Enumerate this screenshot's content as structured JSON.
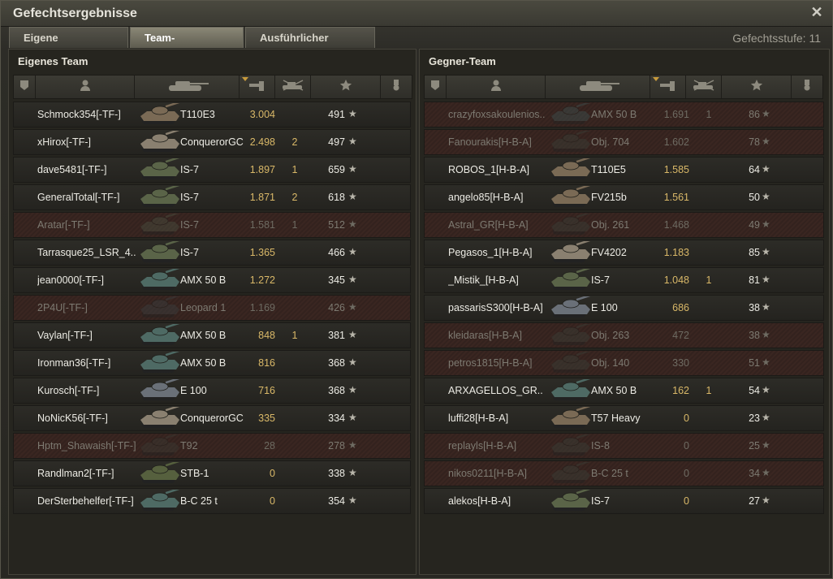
{
  "window": {
    "title": "Gefechtsergebnisse",
    "close_icon": "✕"
  },
  "tabs": [
    {
      "label": "Eigene Auswertung",
      "active": false
    },
    {
      "label": "Team-Auswertung",
      "active": true
    },
    {
      "label": "Ausführlicher Bericht",
      "active": false
    }
  ],
  "battle_level": {
    "label": "Gefechtsstufe:",
    "value": "11"
  },
  "columns": [
    {
      "icon": "platoon-icon"
    },
    {
      "icon": "player-icon"
    },
    {
      "icon": "tank-icon"
    },
    {
      "icon": "damage-icon",
      "sorted": true
    },
    {
      "icon": "kills-icon"
    },
    {
      "icon": "star-icon"
    },
    {
      "icon": "medal-icon"
    }
  ],
  "own_team": {
    "title": "Eigenes Team",
    "rows": [
      {
        "name": "Schmock354[-TF-]",
        "vehicle": "T110E3",
        "damage": "3.004",
        "kills": "",
        "xp": "491",
        "dead": false,
        "tank_color": "#7a6a55"
      },
      {
        "name": "xHirox[-TF-]",
        "vehicle": "ConquerorGC",
        "damage": "2.498",
        "kills": "2",
        "xp": "497",
        "dead": false,
        "tank_color": "#8a8070"
      },
      {
        "name": "dave5481[-TF-]",
        "vehicle": "IS-7",
        "damage": "1.897",
        "kills": "1",
        "xp": "659",
        "dead": false,
        "tank_color": "#5a6448"
      },
      {
        "name": "GeneralTotal[-TF-]",
        "vehicle": "IS-7",
        "damage": "1.871",
        "kills": "2",
        "xp": "618",
        "dead": false,
        "tank_color": "#5a6448"
      },
      {
        "name": "Aratar[-TF-]",
        "vehicle": "IS-7",
        "damage": "1.581",
        "kills": "1",
        "xp": "512",
        "dead": true,
        "tank_color": "#4a5040"
      },
      {
        "name": "Tarrasque25_LSR_4..",
        "vehicle": "IS-7",
        "damage": "1.365",
        "kills": "",
        "xp": "466",
        "dead": false,
        "tank_color": "#5a6448"
      },
      {
        "name": "jean0000[-TF-]",
        "vehicle": "AMX 50 B",
        "damage": "1.272",
        "kills": "",
        "xp": "345",
        "dead": false,
        "tank_color": "#4e6a64"
      },
      {
        "name": "2P4U[-TF-]",
        "vehicle": "Leopard 1",
        "damage": "1.169",
        "kills": "",
        "xp": "426",
        "dead": true,
        "tank_color": "#3a4040"
      },
      {
        "name": "Vaylan[-TF-]",
        "vehicle": "AMX 50 B",
        "damage": "848",
        "kills": "1",
        "xp": "381",
        "dead": false,
        "tank_color": "#4e6a64"
      },
      {
        "name": "Ironman36[-TF-]",
        "vehicle": "AMX 50 B",
        "damage": "816",
        "kills": "",
        "xp": "368",
        "dead": false,
        "tank_color": "#4e6a64"
      },
      {
        "name": "Kurosch[-TF-]",
        "vehicle": "E 100",
        "damage": "716",
        "kills": "",
        "xp": "368",
        "dead": false,
        "tank_color": "#6a7078"
      },
      {
        "name": "NoNicK56[-TF-]",
        "vehicle": "ConquerorGC",
        "damage": "335",
        "kills": "",
        "xp": "334",
        "dead": false,
        "tank_color": "#8a8070"
      },
      {
        "name": "Hptm_Shawaish[-TF-]",
        "vehicle": "T92",
        "damage": "28",
        "kills": "",
        "xp": "278",
        "dead": true,
        "tank_color": "#3a3a34"
      },
      {
        "name": "Randlman2[-TF-]",
        "vehicle": "STB-1",
        "damage": "0",
        "kills": "",
        "xp": "338",
        "dead": false,
        "tank_color": "#56603e"
      },
      {
        "name": "DerSterbehelfer[-TF-]",
        "vehicle": "B-C 25 t",
        "damage": "0",
        "kills": "",
        "xp": "354",
        "dead": false,
        "tank_color": "#4e6a64"
      }
    ]
  },
  "enemy_team": {
    "title": "Gegner-Team",
    "rows": [
      {
        "name": "crazyfoxsakoulenios..",
        "vehicle": "AMX 50 B",
        "damage": "1.691",
        "kills": "1",
        "xp": "86",
        "dead": true,
        "tank_color": "#3e5250"
      },
      {
        "name": "Fanourakis[H-B-A]",
        "vehicle": "Obj. 704",
        "damage": "1.602",
        "kills": "",
        "xp": "78",
        "dead": true,
        "tank_color": "#3a4038"
      },
      {
        "name": "ROBOS_1[H-B-A]",
        "vehicle": "T110E5",
        "damage": "1.585",
        "kills": "",
        "xp": "64",
        "dead": false,
        "tank_color": "#7a6a55"
      },
      {
        "name": "angelo85[H-B-A]",
        "vehicle": "FV215b",
        "damage": "1.561",
        "kills": "",
        "xp": "50",
        "dead": false,
        "tank_color": "#7a6a55"
      },
      {
        "name": "Astral_GR[H-B-A]",
        "vehicle": "Obj. 261",
        "damage": "1.468",
        "kills": "",
        "xp": "49",
        "dead": true,
        "tank_color": "#3a4038"
      },
      {
        "name": "Pegasos_1[H-B-A]",
        "vehicle": "FV4202",
        "damage": "1.183",
        "kills": "",
        "xp": "85",
        "dead": false,
        "tank_color": "#8a8070"
      },
      {
        "name": "_Mistik_[H-B-A]",
        "vehicle": "IS-7",
        "damage": "1.048",
        "kills": "1",
        "xp": "81",
        "dead": false,
        "tank_color": "#5a6448"
      },
      {
        "name": "passarisS300[H-B-A]",
        "vehicle": "E 100",
        "damage": "686",
        "kills": "",
        "xp": "38",
        "dead": false,
        "tank_color": "#6a7078"
      },
      {
        "name": "kleidaras[H-B-A]",
        "vehicle": "Obj. 263",
        "damage": "472",
        "kills": "",
        "xp": "38",
        "dead": true,
        "tank_color": "#3a4038"
      },
      {
        "name": "petros1815[H-B-A]",
        "vehicle": "Obj. 140",
        "damage": "330",
        "kills": "",
        "xp": "51",
        "dead": true,
        "tank_color": "#3a4038"
      },
      {
        "name": "ARXAGELLOS_GR..",
        "vehicle": "AMX 50 B",
        "damage": "162",
        "kills": "1",
        "xp": "54",
        "dead": false,
        "tank_color": "#4e6a64"
      },
      {
        "name": "luffi28[H-B-A]",
        "vehicle": "T57 Heavy",
        "damage": "0",
        "kills": "",
        "xp": "23",
        "dead": false,
        "tank_color": "#7a6a55"
      },
      {
        "name": "replayls[H-B-A]",
        "vehicle": "IS-8",
        "damage": "0",
        "kills": "",
        "xp": "25",
        "dead": true,
        "tank_color": "#3a4038"
      },
      {
        "name": "nikos0211[H-B-A]",
        "vehicle": "B-C 25 t",
        "damage": "0",
        "kills": "",
        "xp": "34",
        "dead": true,
        "tank_color": "#3a4038"
      },
      {
        "name": "alekos[H-B-A]",
        "vehicle": "IS-7",
        "damage": "0",
        "kills": "",
        "xp": "27",
        "dead": false,
        "tank_color": "#5a6448"
      }
    ]
  },
  "colors": {
    "accent": "#d9b868",
    "dead_row": "#3a2621",
    "text": "#ecebe4"
  }
}
